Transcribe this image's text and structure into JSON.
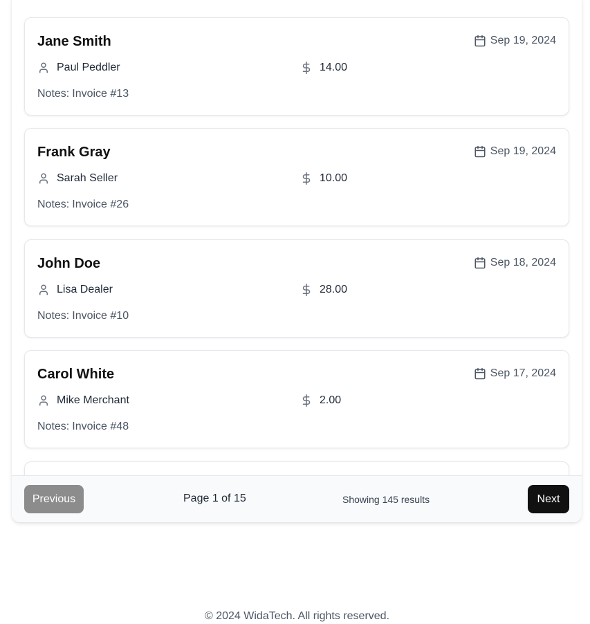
{
  "invoices": [
    {
      "customer": "Jane Smith",
      "date": "Sep 19, 2024",
      "seller": "Paul Peddler",
      "amount": "14.00",
      "notes_prefix": "Notes:",
      "notes": "Invoice #13"
    },
    {
      "customer": "Frank Gray",
      "date": "Sep 19, 2024",
      "seller": "Sarah Seller",
      "amount": "10.00",
      "notes_prefix": "Notes:",
      "notes": "Invoice #26"
    },
    {
      "customer": "John Doe",
      "date": "Sep 18, 2024",
      "seller": "Lisa Dealer",
      "amount": "28.00",
      "notes_prefix": "Notes:",
      "notes": "Invoice #10"
    },
    {
      "customer": "Carol White",
      "date": "Sep 17, 2024",
      "seller": "Mike Merchant",
      "amount": "2.00",
      "notes_prefix": "Notes:",
      "notes": "Invoice #48"
    }
  ],
  "pagination": {
    "previous_label": "Previous",
    "next_label": "Next",
    "page_text": "Page 1 of 15",
    "results_text": "Showing 145 results"
  },
  "footer": {
    "copyright": "© 2024 WidaTech. All rights reserved."
  },
  "icons": {
    "date": "calendar-icon",
    "seller": "user-icon",
    "amount": "dollar-icon"
  },
  "colors": {
    "next_button": "#111111",
    "previous_button_disabled": "#8c8c8c",
    "card_border": "#e5e7eb"
  }
}
